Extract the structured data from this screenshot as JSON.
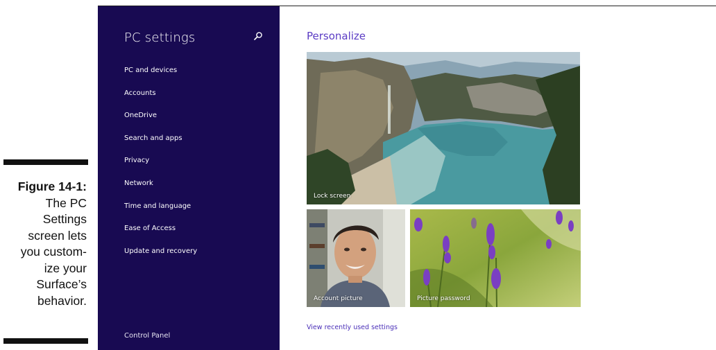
{
  "caption": {
    "label": "Figure 14-1:",
    "lines": [
      "The PC",
      "Settings",
      "screen lets",
      "you custom-",
      "ize your",
      "Surface’s",
      "behavior."
    ]
  },
  "sidebar": {
    "title": "PC settings",
    "search_icon": "search-icon",
    "items": [
      {
        "label": "PC and devices"
      },
      {
        "label": "Accounts"
      },
      {
        "label": "OneDrive"
      },
      {
        "label": "Search and apps"
      },
      {
        "label": "Privacy"
      },
      {
        "label": "Network"
      },
      {
        "label": "Time and language"
      },
      {
        "label": "Ease of Access"
      },
      {
        "label": "Update and recovery"
      }
    ],
    "control_panel": "Control Panel",
    "bg_color": "#180a52"
  },
  "main": {
    "heading": "Personalize",
    "accent_color": "#5b3cc4",
    "tiles": {
      "lock_screen": "Lock screen",
      "account_picture": "Account picture",
      "picture_password": "Picture password"
    },
    "recent_link": "View recently used settings"
  }
}
